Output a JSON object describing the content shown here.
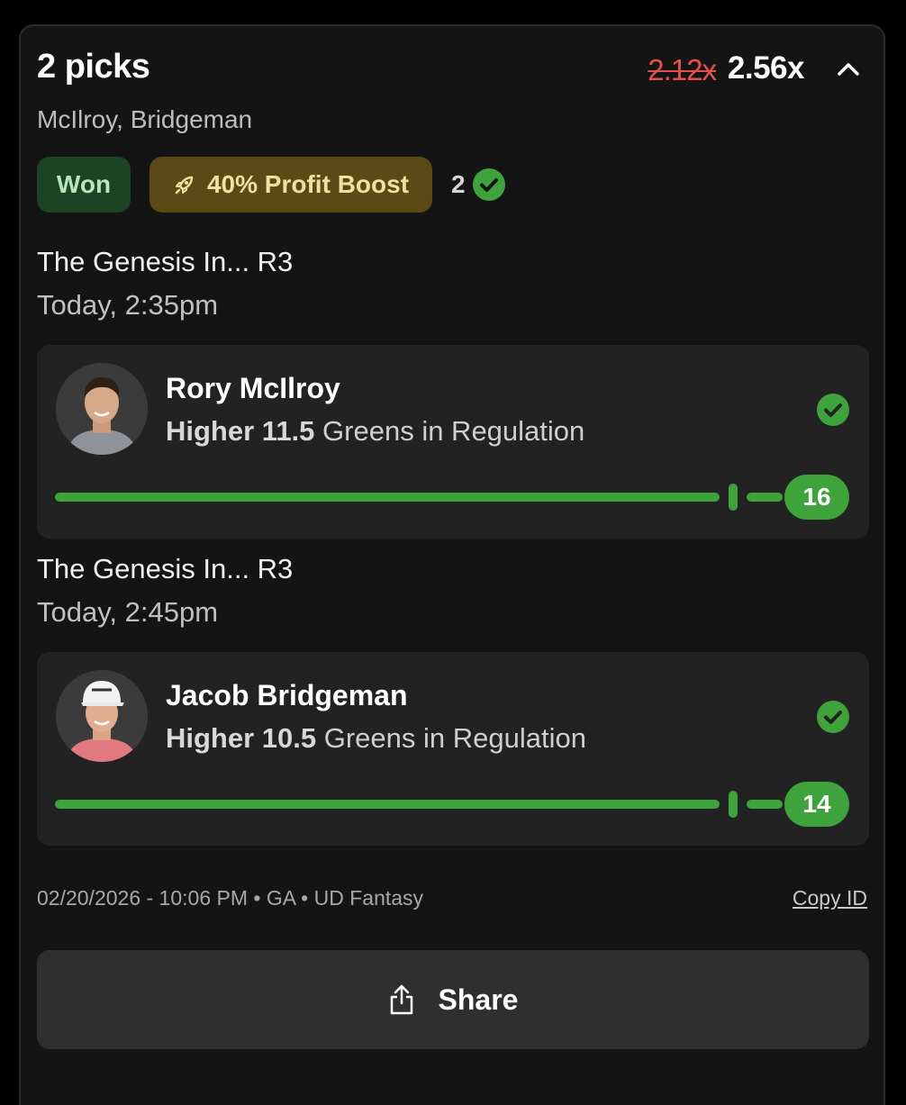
{
  "header": {
    "title": "2 picks",
    "multiplier_old": "2.12x",
    "multiplier_new": "2.56x",
    "players_summary": "McIlroy, Bridgeman"
  },
  "badges": {
    "status": "Won",
    "boost": "40% Profit Boost",
    "correct_count": "2"
  },
  "picks": [
    {
      "game": "The Genesis In... R3",
      "time": "Today, 2:35pm",
      "player": "Rory McIlroy",
      "line": "Higher 11.5",
      "stat": "Greens in Regulation",
      "result": "16",
      "progress": 1.0
    },
    {
      "game": "The Genesis In... R3",
      "time": "Today, 2:45pm",
      "player": "Jacob Bridgeman",
      "line": "Higher 10.5",
      "stat": "Greens in Regulation",
      "result": "14",
      "progress": 1.0
    }
  ],
  "footer": {
    "meta": "02/20/2026 - 10:06 PM • GA • UD Fantasy",
    "copy_id": "Copy ID",
    "share": "Share"
  },
  "colors": {
    "accent_green": "#3da33a",
    "won_bg": "#1c4424",
    "boost_bg": "#5b4a15",
    "strike_red": "#e5514a"
  },
  "icons": [
    "chevron-up-icon",
    "rocket-icon",
    "check-circle-icon",
    "share-icon"
  ]
}
